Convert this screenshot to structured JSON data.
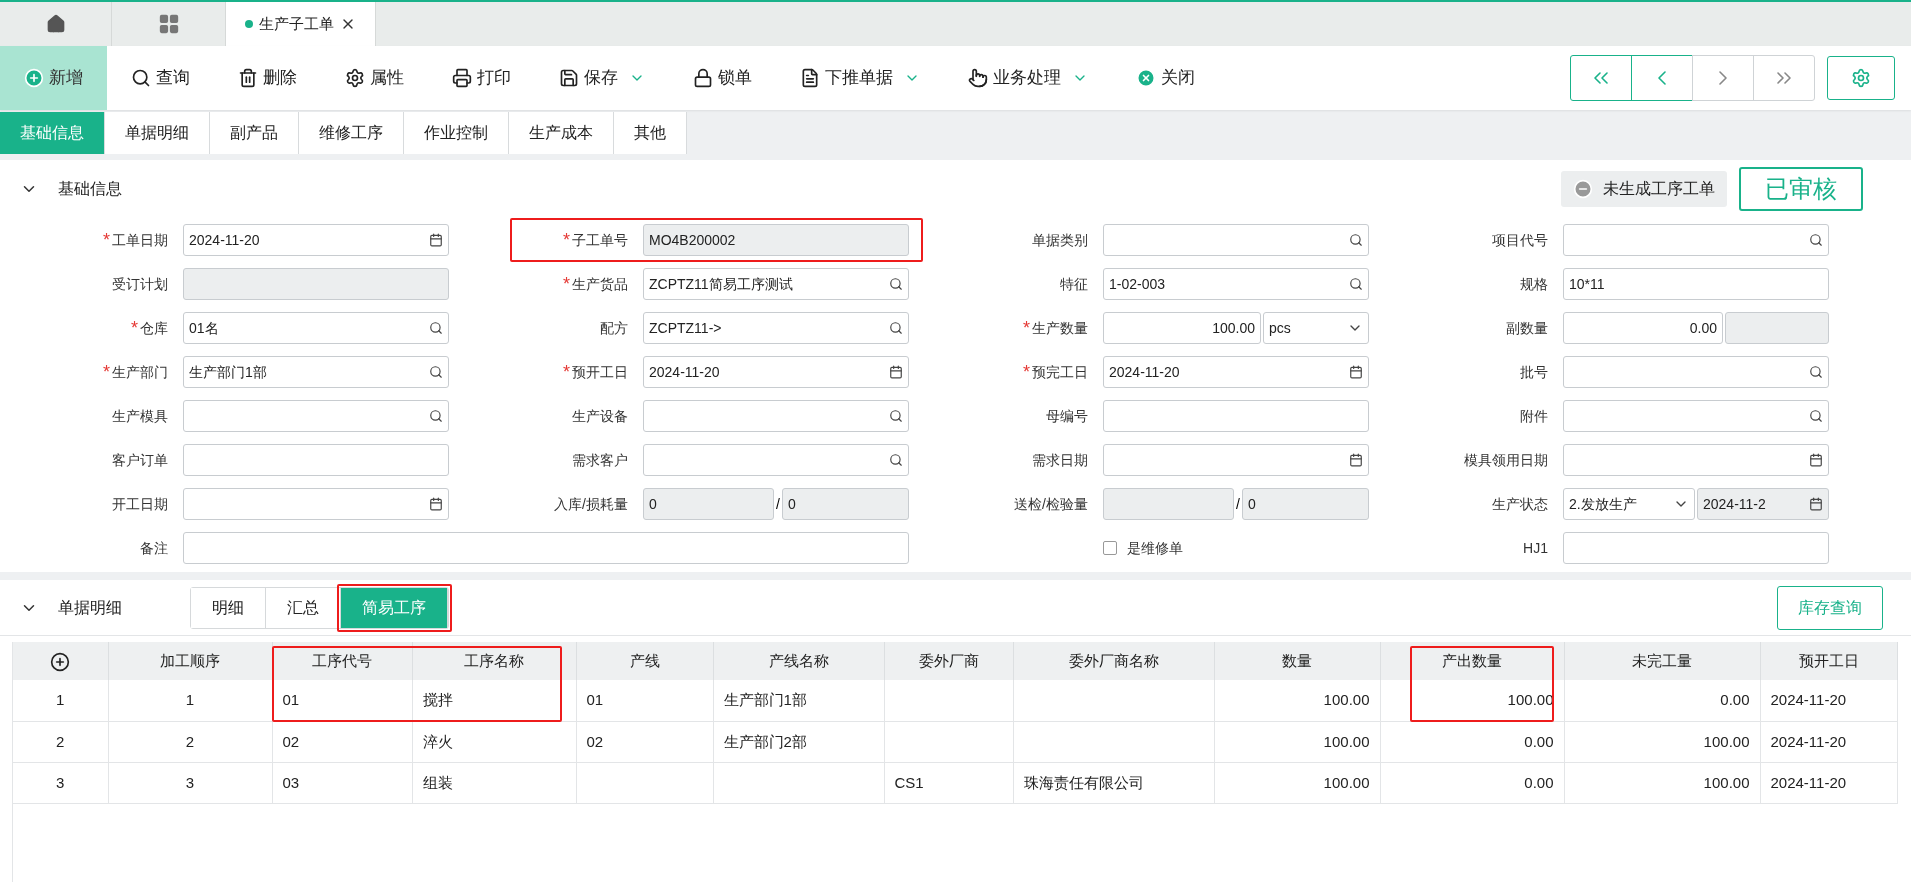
{
  "window_tabs": [
    {
      "kind": "home",
      "selected": false
    },
    {
      "kind": "grid",
      "selected": false
    },
    {
      "kind": "page",
      "label": "生产子工单",
      "selected": true
    }
  ],
  "toolbar": [
    {
      "label": "新增",
      "selected": true,
      "dropdown": false
    },
    {
      "label": "查询",
      "selected": false,
      "dropdown": false
    },
    {
      "label": "删除",
      "selected": false,
      "dropdown": false
    },
    {
      "label": "属性",
      "selected": false,
      "dropdown": false
    },
    {
      "label": "打印",
      "selected": false,
      "dropdown": false
    },
    {
      "label": "保存",
      "selected": false,
      "dropdown": true
    },
    {
      "label": "锁单",
      "selected": false,
      "dropdown": false
    },
    {
      "label": "下推单据",
      "selected": false,
      "dropdown": true
    },
    {
      "label": "业务处理",
      "selected": false,
      "dropdown": true
    },
    {
      "label": "关闭",
      "selected": false,
      "dropdown": false
    }
  ],
  "section_tabs": [
    {
      "label": "基础信息",
      "selected": true
    },
    {
      "label": "单据明细",
      "selected": false
    },
    {
      "label": "副产品",
      "selected": false
    },
    {
      "label": "维修工序",
      "selected": false
    },
    {
      "label": "作业控制",
      "selected": false
    },
    {
      "label": "生产成本",
      "selected": false
    },
    {
      "label": "其他",
      "selected": false
    }
  ],
  "basic_section": {
    "title": "基础信息",
    "expanded": true,
    "badge": "未生成工序工单",
    "stamp": "已审核"
  },
  "form_rows": [
    [
      {
        "label": "工单日期",
        "mark": "*",
        "kind": "date",
        "value": "2024-11-20"
      },
      {
        "label": "子工单号",
        "mark": "*",
        "kind": "readonly",
        "value": "MO4B200002",
        "highlighted": true
      },
      {
        "label": "单据类别",
        "kind": "search"
      },
      {
        "label": "项目代号",
        "kind": "search"
      }
    ],
    [
      {
        "label": "受订计划",
        "kind": "readonly"
      },
      {
        "label": "生产货品",
        "mark": "*",
        "kind": "search",
        "value": "ZCPTZ11简易工序测试"
      },
      {
        "label": "特征",
        "kind": "search",
        "value": "1-02-003"
      },
      {
        "label": "规格",
        "kind": "text",
        "value": "10*11"
      }
    ],
    [
      {
        "label": "仓库",
        "mark": "*",
        "kind": "search",
        "value": "01名"
      },
      {
        "label": "配方",
        "kind": "search",
        "value": "ZCPTZ11->"
      },
      {
        "label": "生产数量",
        "mark": "*",
        "kind": "qty_unit",
        "value": "100.00",
        "unit": "pcs"
      },
      {
        "label": "副数量",
        "kind": "qty_extra",
        "value": "0.00"
      }
    ],
    [
      {
        "label": "生产部门",
        "mark": "*",
        "kind": "search",
        "value": "生产部门1部"
      },
      {
        "label": "预开工日",
        "mark": "*",
        "kind": "date",
        "value": "2024-11-20"
      },
      {
        "label": "预完工日",
        "mark": "*",
        "kind": "date",
        "value": "2024-11-20"
      },
      {
        "label": "批号",
        "kind": "search"
      }
    ],
    [
      {
        "label": "生产模具",
        "kind": "search"
      },
      {
        "label": "生产设备",
        "kind": "search"
      },
      {
        "label": "母编号",
        "kind": "text"
      },
      {
        "label": "附件",
        "kind": "search"
      }
    ],
    [
      {
        "label": "客户订单",
        "kind": "text"
      },
      {
        "label": "需求客户",
        "kind": "search"
      },
      {
        "label": "需求日期",
        "kind": "date"
      },
      {
        "label": "模具领用日期",
        "kind": "date"
      }
    ],
    [
      {
        "label": "开工日期",
        "kind": "date"
      },
      {
        "label": "入库/损耗量",
        "kind": "split",
        "value": "0",
        "separator": "/",
        "value2": "0"
      },
      {
        "label": "送检/检验量",
        "kind": "split",
        "separator": "/",
        "value2": "0"
      },
      {
        "label": "生产状态",
        "kind": "select_date",
        "value": "2.发放生产",
        "value2": "2024-11-2"
      }
    ],
    [
      {
        "label": "备注",
        "kind": "wide"
      },
      {
        "label": "是维修单",
        "kind": "checkbox",
        "checked": false
      },
      {
        "label": "HJ1",
        "kind": "text"
      }
    ]
  ],
  "detail_section": {
    "title": "单据明细",
    "expanded": true,
    "tabs": [
      {
        "label": "明细",
        "selected": false
      },
      {
        "label": "汇总",
        "selected": false
      },
      {
        "label": "简易工序",
        "selected": true,
        "highlighted": true
      }
    ],
    "button": "库存查询"
  },
  "table": {
    "columns": [
      {
        "kind": "add"
      },
      {
        "label": "加工顺序"
      },
      {
        "label": "工序代号",
        "highlighted": true
      },
      {
        "label": "工序名称",
        "highlighted": true
      },
      {
        "label": "产线"
      },
      {
        "label": "产线名称"
      },
      {
        "label": "委外厂商"
      },
      {
        "label": "委外厂商名称"
      },
      {
        "label": "数量"
      },
      {
        "label": "产出数量",
        "highlighted": true
      },
      {
        "label": "未完工量"
      },
      {
        "label": "预开工日"
      }
    ],
    "rows": [
      [
        "1",
        "1",
        "01",
        "搅拌",
        "01",
        "生产部门1部",
        null,
        null,
        "100.00",
        "100.00",
        "0.00",
        "2024-11-20"
      ],
      [
        "2",
        "2",
        "02",
        "淬火",
        "02",
        "生产部门2部",
        null,
        null,
        "100.00",
        "0.00",
        "100.00",
        "2024-11-20"
      ],
      [
        "3",
        "3",
        "03",
        "组装",
        null,
        null,
        "CS1",
        "珠海责任有限公司",
        "100.00",
        "0.00",
        "100.00",
        "2024-11-20"
      ]
    ]
  }
}
